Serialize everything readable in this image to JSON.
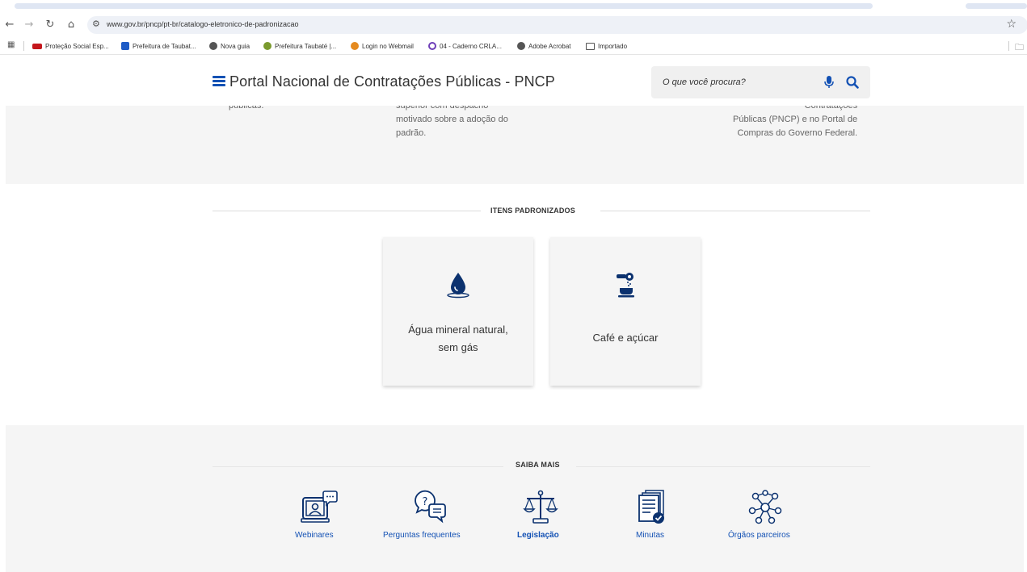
{
  "browser": {
    "url": "www.gov.br/pncp/pt-br/catalogo-eletronico-de-padronizacao",
    "bookmarks": [
      {
        "label": "Proteção Social Esp..."
      },
      {
        "label": "Prefeitura de Taubat..."
      },
      {
        "label": "Nova guia"
      },
      {
        "label": "Prefeitura Taubaté |..."
      },
      {
        "label": "Login no Webmail"
      },
      {
        "label": "04 - Caderno CRLA..."
      },
      {
        "label": "Adobe Acrobat"
      },
      {
        "label": "Importado"
      }
    ]
  },
  "header": {
    "title": "Portal Nacional de Contratações Públicas - PNCP",
    "search_placeholder": "O que você procura?"
  },
  "top_section": {
    "col1_line": "públicas.",
    "col2_lines": [
      "superior com despacho",
      "motivado sobre a adoção do",
      "padrão."
    ],
    "col3_lines": [
      "Contratações",
      "Públicas (PNCP) e no Portal de",
      "Compras do Governo Federal."
    ]
  },
  "itens": {
    "title": "ITENS PADRONIZADOS",
    "cards": [
      {
        "label_line1": "Água mineral natural,",
        "label_line2": "sem gás",
        "icon": "water-drop-icon"
      },
      {
        "label": "Café e açúcar",
        "icon": "coffee-sugar-icon"
      }
    ]
  },
  "saiba_mais": {
    "title": "SAIBA MAIS",
    "links": [
      {
        "label": "Webinares",
        "icon": "webinar-icon"
      },
      {
        "label": "Perguntas frequentes",
        "icon": "faq-icon"
      },
      {
        "label": "Legislação",
        "icon": "scales-icon"
      },
      {
        "label": "Minutas",
        "icon": "documents-icon"
      },
      {
        "label": "Órgãos parceiros",
        "icon": "network-icon"
      }
    ]
  },
  "colors": {
    "brand_blue": "#1351b4",
    "dark_navy": "#0c326f",
    "section_bg": "#f5f5f5"
  }
}
